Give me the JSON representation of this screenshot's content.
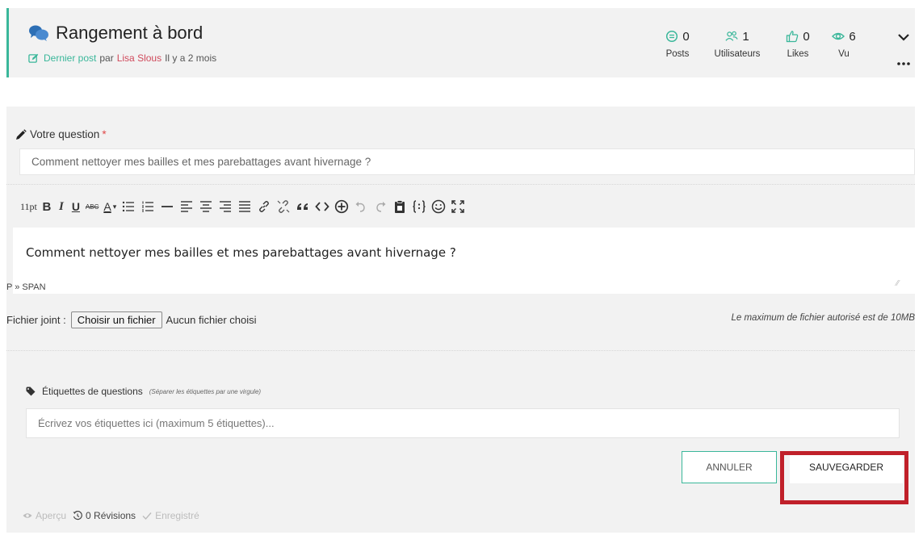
{
  "topic": {
    "title": "Rangement à bord",
    "last_post_label": "Dernier post",
    "last_post_by": "par",
    "last_post_author": "Lisa Slous",
    "last_post_when": "Il y a 2 mois"
  },
  "stats": {
    "posts": {
      "value": "0",
      "label": "Posts"
    },
    "users": {
      "value": "1",
      "label": "Utilisateurs"
    },
    "likes": {
      "value": "0",
      "label": "Likes"
    },
    "views": {
      "value": "6",
      "label": "Vu"
    }
  },
  "form": {
    "question_label": "Votre question",
    "required_mark": "*",
    "question_value": "Comment nettoyer mes bailles et mes parebattages avant hivernage ?",
    "toolbar": {
      "font_size": "11pt",
      "bold": "B",
      "italic": "I",
      "underline": "U",
      "strike": "ABC",
      "color": "A",
      "color_caret": "▾"
    },
    "editor_content": "Comment nettoyer mes bailles et mes parebattages avant hivernage ?",
    "editor_path": "P » SPAN",
    "file_label": "Fichier joint :",
    "file_button": "Choisir un fichier",
    "file_none": "Aucun fichier choisi",
    "file_max": "Le maximum de fichier autorisé est de 10MB",
    "tags_label": "Étiquettes de questions",
    "tags_hint": "(Séparer les étiquettes par une virgule)",
    "tags_placeholder": "Écrivez vos étiquettes ici (maximum 5 étiquettes)...",
    "cancel_label": "ANNULER",
    "save_label": "SAUVEGARDER"
  },
  "bottom": {
    "preview": "Aperçu",
    "revisions": "0 Révisions",
    "saved": "Enregistré"
  },
  "colors": {
    "accent": "#3ab79a",
    "author": "#d04a5c",
    "highlight": "#c0202a",
    "required": "#e04a4a"
  }
}
